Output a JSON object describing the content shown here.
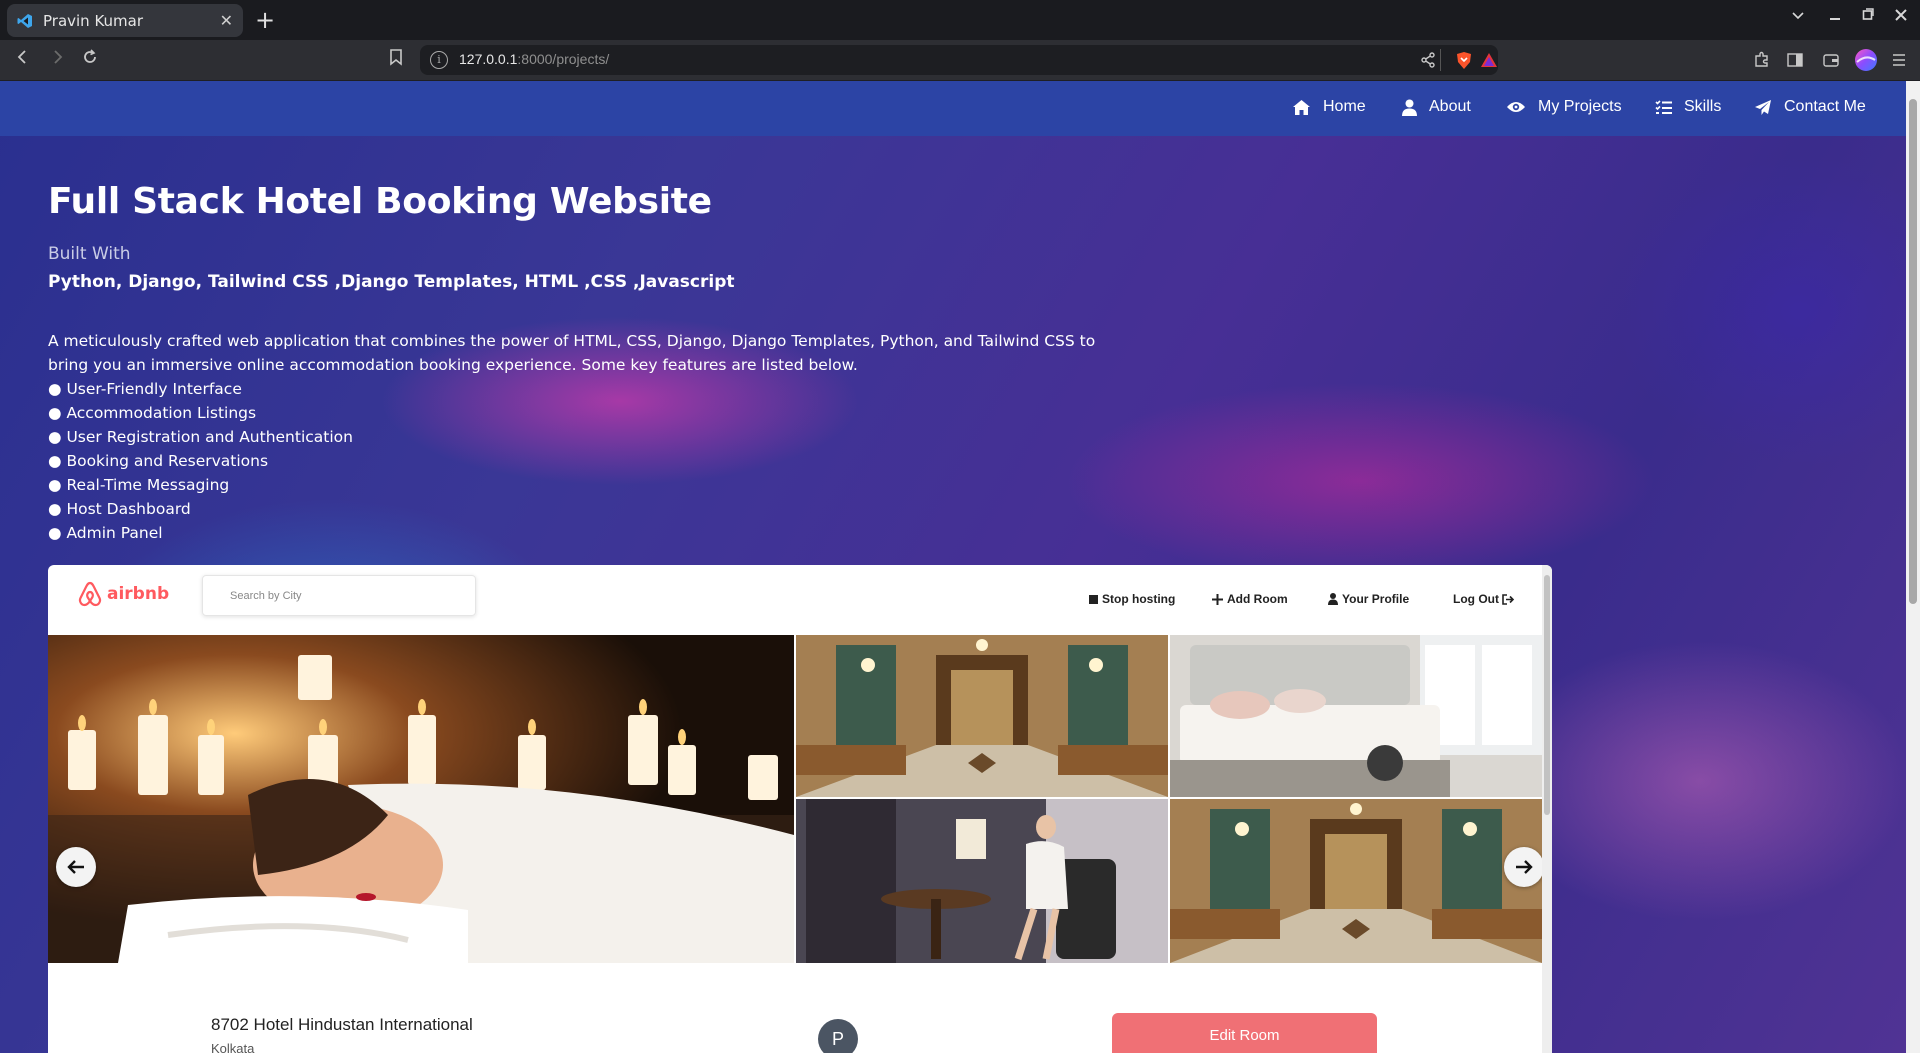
{
  "browser": {
    "tab_title": "Pravin Kumar",
    "url_host": "127.0.0.1",
    "url_path": ":8000/projects/"
  },
  "nav": {
    "items": [
      {
        "label": "Home",
        "icon": "home-icon"
      },
      {
        "label": "About",
        "icon": "user-icon"
      },
      {
        "label": "My Projects",
        "icon": "eye-icon"
      },
      {
        "label": "Skills",
        "icon": "list-icon"
      },
      {
        "label": "Contact Me",
        "icon": "paper-plane-icon"
      }
    ]
  },
  "project": {
    "title": "Full Stack Hotel Booking Website",
    "built_with_label": "Built With",
    "tech_stack": "Python, Django, Tailwind CSS ,Django Templates, HTML ,CSS ,Javascript",
    "description": "A meticulously crafted web application that combines the power of HTML, CSS, Django, Django Templates, Python, and Tailwind CSS to bring you an immersive online accommodation booking experience. Some key features are listed below.",
    "features": [
      "User-Friendly Interface",
      "Accommodation Listings",
      "User Registration and Authentication",
      "Booking and Reservations",
      "Real-Time Messaging",
      "Host Dashboard",
      "Admin Panel"
    ]
  },
  "preview": {
    "logo_text": "airbnb",
    "search_placeholder": "Search by City",
    "links": {
      "stop_hosting": "Stop hosting",
      "add_room": "Add Room",
      "profile": "Your Profile",
      "logout": "Log Out"
    },
    "room_name": "8702 Hotel Hindustan International",
    "room_city": "Kolkata",
    "host_initial": "P",
    "edit_button": "Edit Room"
  },
  "colors": {
    "nav_bg": "#2c44a5",
    "airbnb_brand": "#ff5a5f",
    "edit_button": "#f07075"
  }
}
